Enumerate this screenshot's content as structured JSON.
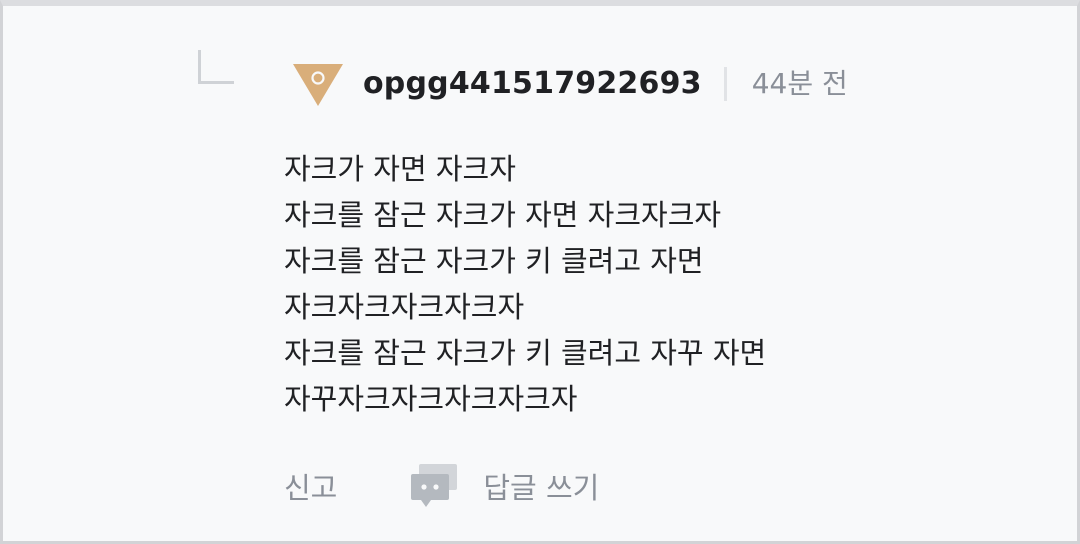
{
  "comment": {
    "username": "opgg441517922693",
    "time": "44분 전",
    "avatar_color": "#d9ae7a",
    "lines": [
      "자크가 자면 자크자",
      "자크를 잠근 자크가 자면 자크자크자",
      "자크를 잠근 자크가 키 클려고 자면",
      "자크자크자크자크자",
      "자크를 잠근 자크가 키 클려고 자꾸 자면",
      "자꾸자크자크자크자크자"
    ],
    "actions": {
      "report_label": "신고",
      "reply_label": "답글 쓰기"
    }
  },
  "icons": {
    "connector": "reply-connector-icon",
    "avatar": "triangle-avatar-icon",
    "reply": "chat-bubble-icon"
  }
}
